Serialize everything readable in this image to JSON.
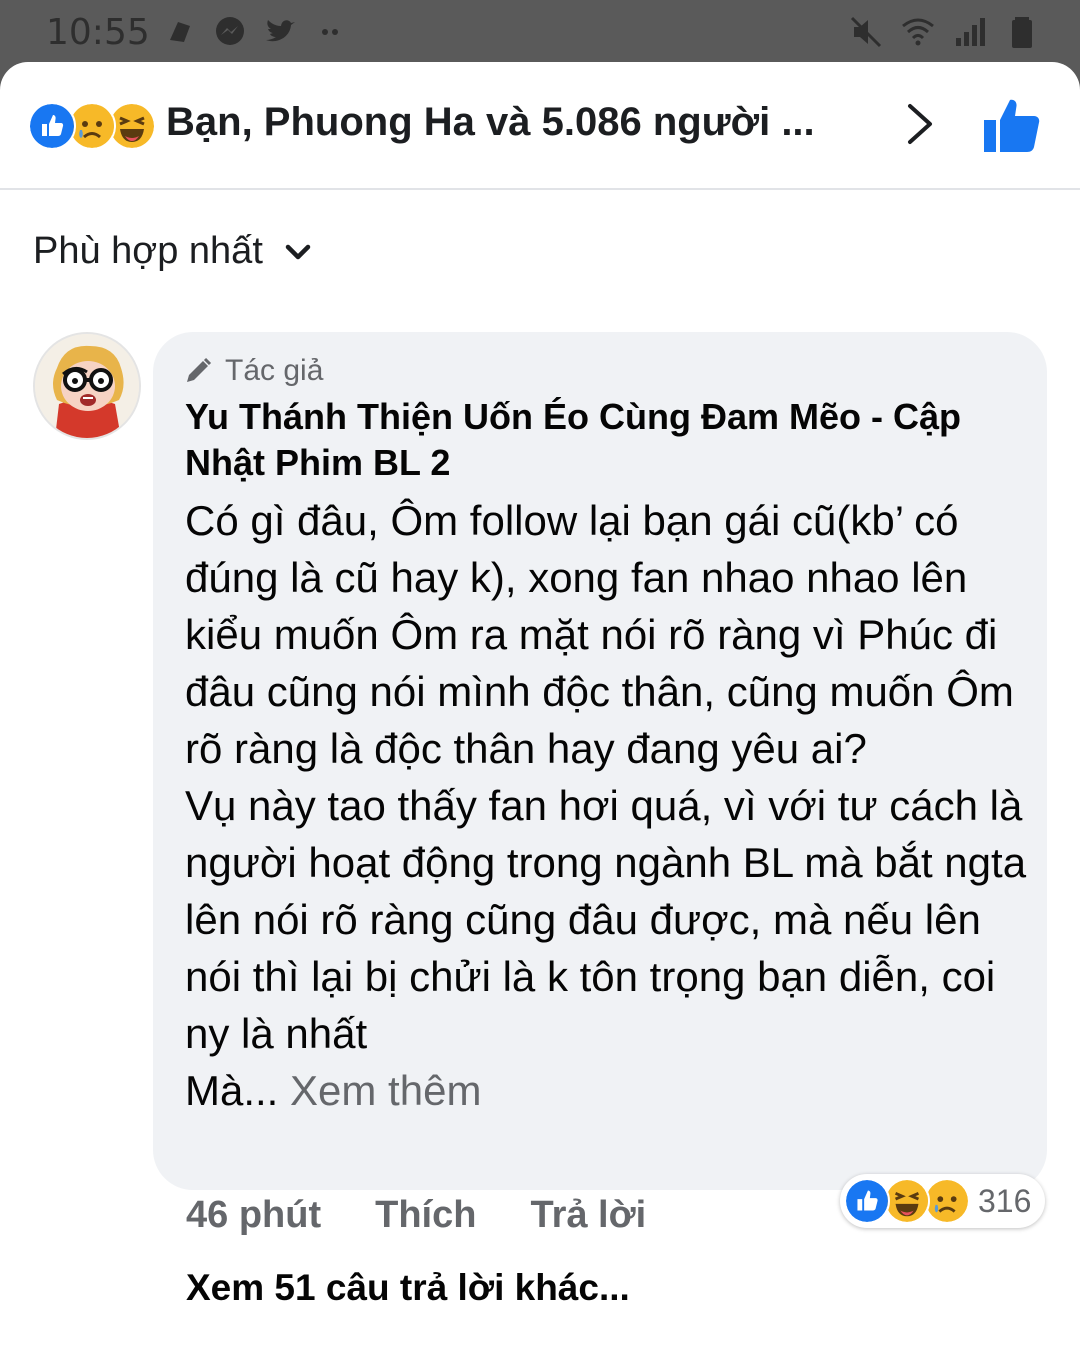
{
  "status_bar": {
    "time": "10:55",
    "left_icons": [
      "app-notification-icon",
      "messenger-icon",
      "twitter-icon",
      "more-dots-icon"
    ],
    "right_icons": [
      "mute-icon",
      "wifi-icon",
      "signal-icon",
      "battery-icon"
    ]
  },
  "header": {
    "reactions": [
      "like",
      "sad",
      "haha"
    ],
    "title": "Bạn, Phuong Ha và 5.086 người ...",
    "chevron": "chevron-right-icon",
    "like_button": "thumbs-up-icon",
    "accent": "#1877f2"
  },
  "sort": {
    "label": "Phù hợp nhất"
  },
  "comment": {
    "author_badge": "Tác giả",
    "author_name": "Yu Thánh Thiện Uốn Éo Cùng Đam Mẽo - Cập Nhật Phim BL 2",
    "text": "Có gì đâu, Ôm follow lại bạn gái cũ(kb’ có đúng là cũ hay k), xong fan nhao nhao lên kiểu muốn Ôm ra mặt nói rõ ràng vì Phúc đi đâu cũng nói mình độc thân, cũng muốn Ôm rõ ràng là độc thân hay đang yêu ai?\nVụ này tao thấy fan hơi quá, vì với tư cách là người hoạt động trong ngành BL mà bắt ngta lên nói rõ ràng cũng đâu được, mà nếu lên nói thì lại bị chửi là k tôn trọng bạn diễn, coi ny là nhất\nMà...",
    "see_more": "Xem thêm",
    "time": "46 phút",
    "like_action": "Thích",
    "reply_action": "Trả lời",
    "reaction_icons": [
      "like",
      "haha",
      "sad"
    ],
    "reaction_count": "316",
    "more_replies": "Xem 51 câu trả lời khác..."
  }
}
